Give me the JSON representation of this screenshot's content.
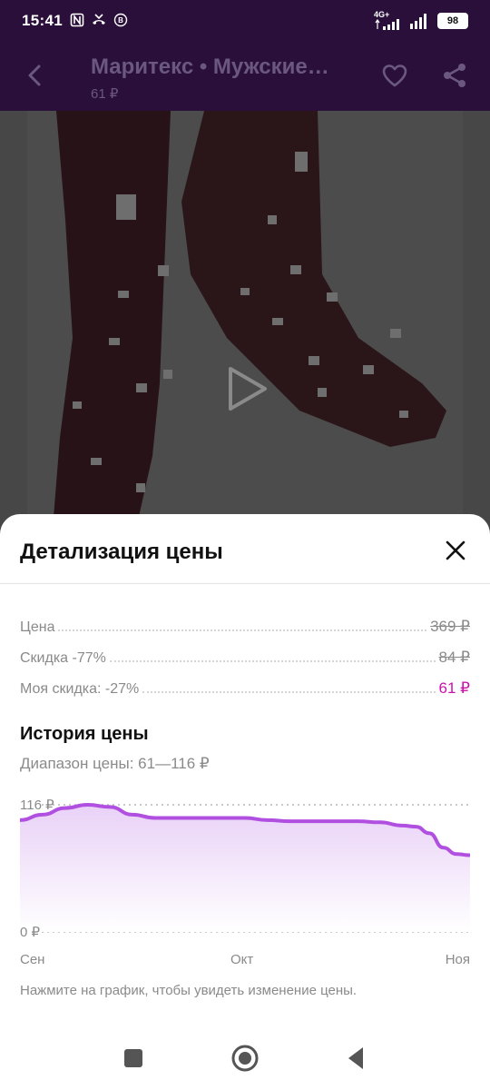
{
  "status_bar": {
    "time": "15:41",
    "icons_left": [
      "nfc-icon",
      "missed-call-icon",
      "vk-icon"
    ],
    "network_label": "4G+",
    "battery": "98"
  },
  "header": {
    "title": "Маритекс • Мужские…",
    "price": "61 ₽"
  },
  "sheet": {
    "title": "Детализация цены",
    "rows": [
      {
        "label": "Цена",
        "value": "369 ₽"
      },
      {
        "label": "Скидка -77%",
        "value": "84 ₽"
      },
      {
        "label": "Моя скидка: -27%",
        "value": "61 ₽"
      }
    ],
    "history_title": "История цены",
    "range_text": "Диапазон цены: 61—116 ₽",
    "hint": "Нажмите на график, чтобы увидеть изменение цены."
  },
  "chart_data": {
    "type": "area",
    "y_labels": [
      "116 ₽",
      "0 ₽"
    ],
    "ylim": [
      0,
      116
    ],
    "x_tick_labels": [
      "Сен",
      "Окт",
      "Ноя"
    ],
    "x": [
      0,
      0.05,
      0.1,
      0.15,
      0.2,
      0.25,
      0.3,
      0.4,
      0.5,
      0.55,
      0.6,
      0.7,
      0.75,
      0.8,
      0.85,
      0.88,
      0.91,
      0.94,
      0.97,
      1.0
    ],
    "values": [
      102,
      107,
      113,
      116,
      114,
      107,
      104,
      104,
      104,
      102,
      101,
      101,
      101,
      100,
      97,
      96,
      90,
      77,
      71,
      70
    ],
    "line_color": "#b04fe0",
    "fill_color": "#e9d1f7"
  },
  "colors": {
    "accent": "#cb11ab",
    "header_bg": "#2a0f3a",
    "header_text": "#6b5880"
  }
}
